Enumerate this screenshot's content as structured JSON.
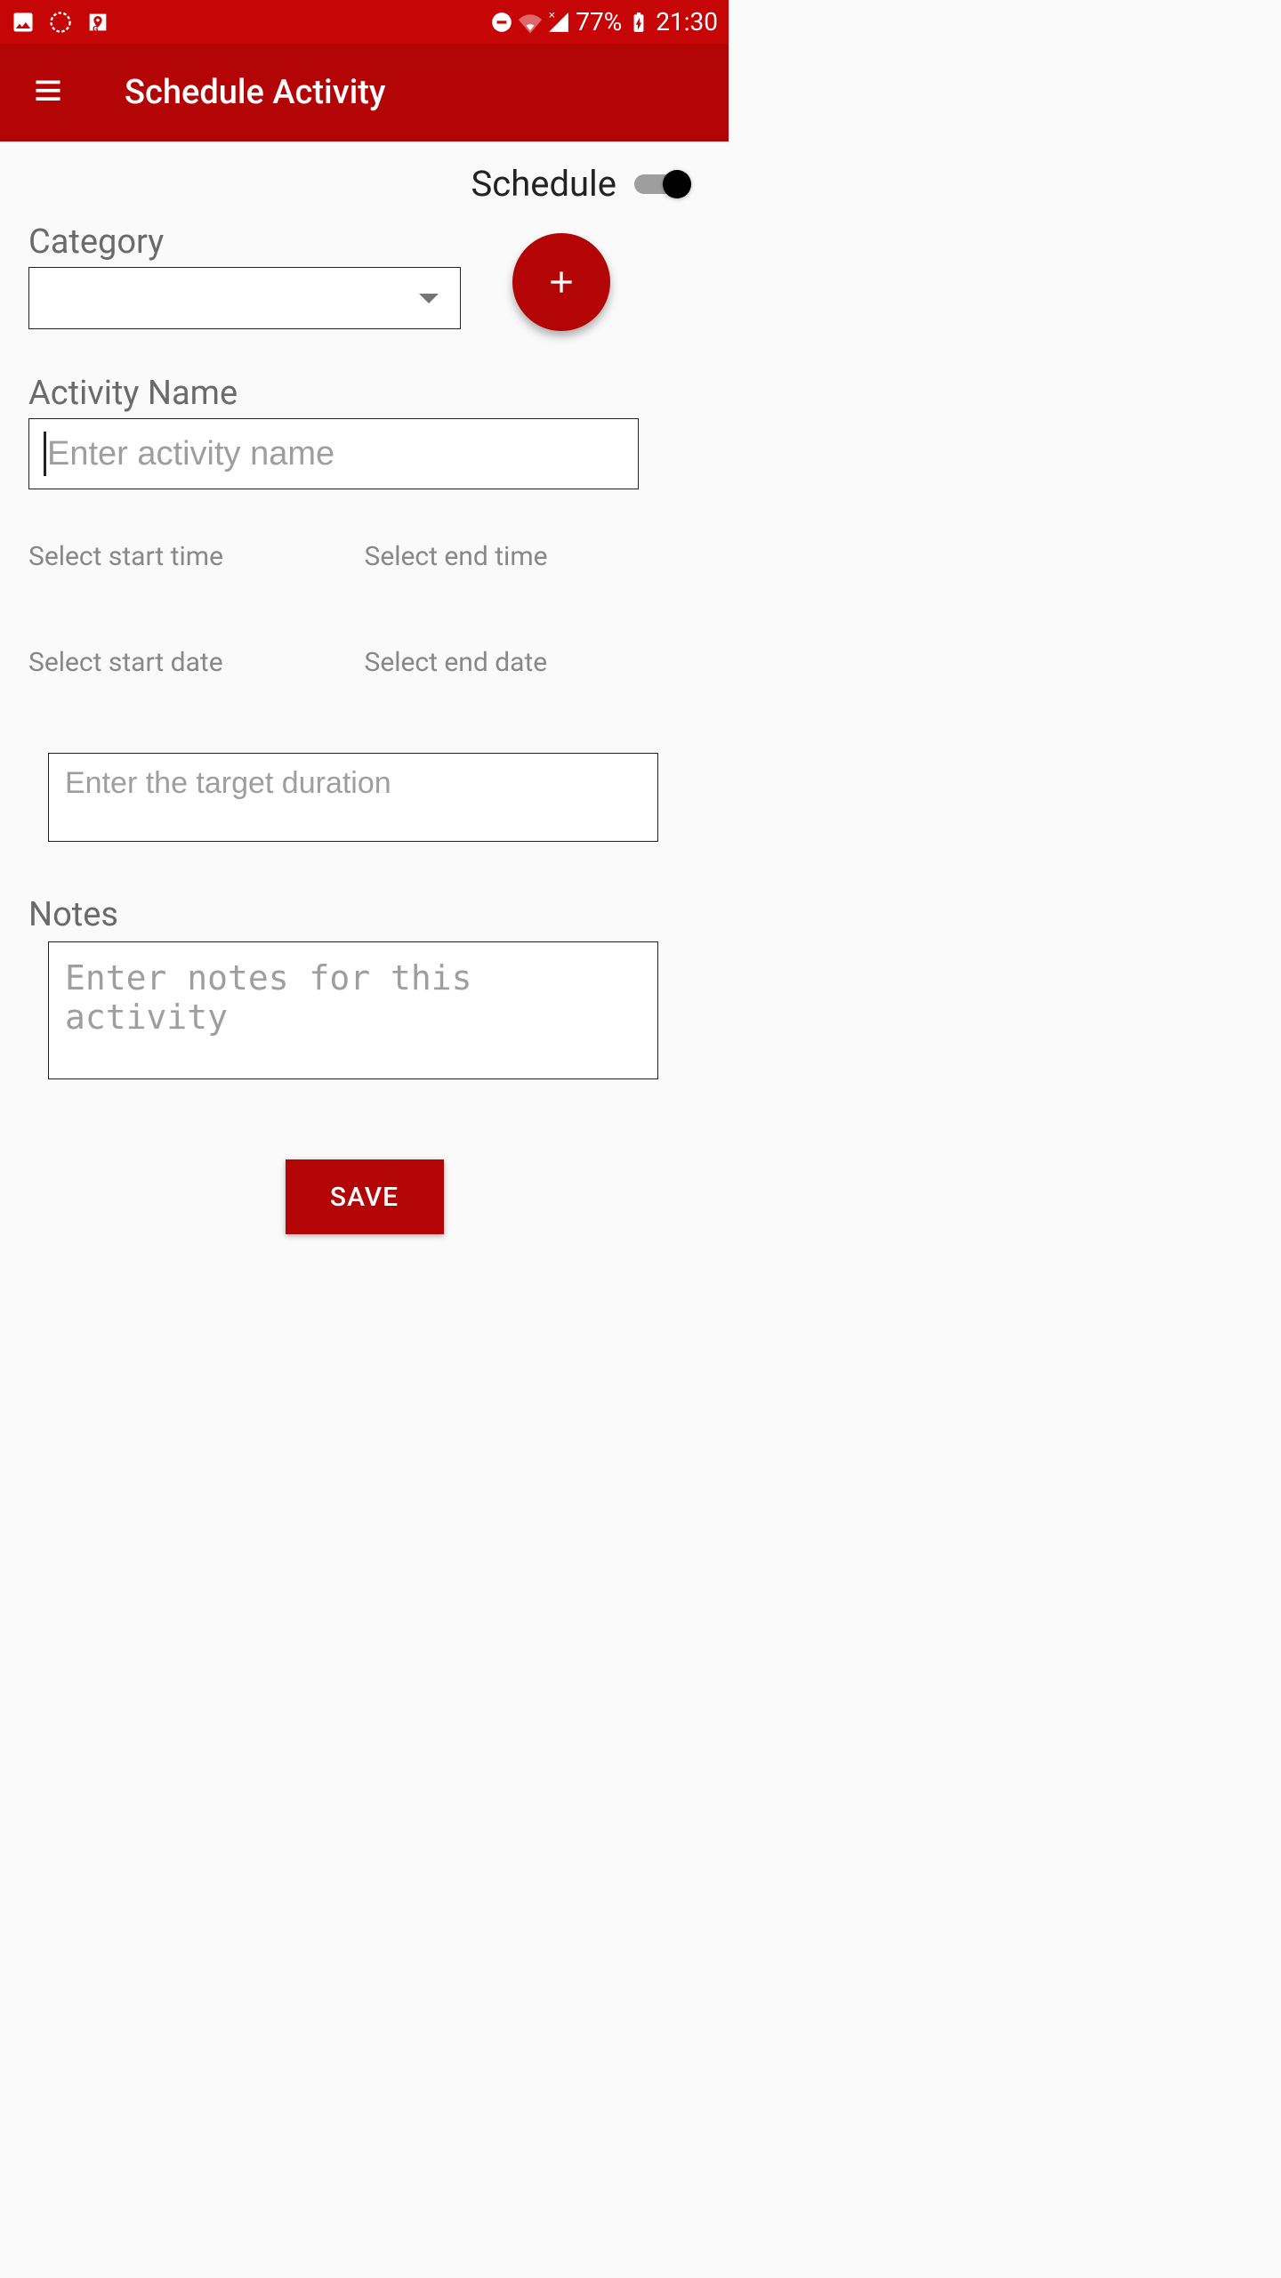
{
  "status_bar": {
    "battery_pct": "77%",
    "time": "21:30"
  },
  "app_bar": {
    "title": "Schedule Activity"
  },
  "toggle": {
    "label": "Schedule",
    "enabled": true
  },
  "category": {
    "label": "Category",
    "selected": ""
  },
  "activity_name": {
    "label": "Activity Name",
    "placeholder": "Enter activity name",
    "value": ""
  },
  "time": {
    "start_label": "Select start time",
    "end_label": "Select end time"
  },
  "date": {
    "start_label": "Select start date",
    "end_label": "Select end date"
  },
  "duration": {
    "placeholder": "Enter the target duration",
    "value": ""
  },
  "notes": {
    "label": "Notes",
    "placeholder": "Enter notes for this activity",
    "value": ""
  },
  "save_button": "SAVE"
}
